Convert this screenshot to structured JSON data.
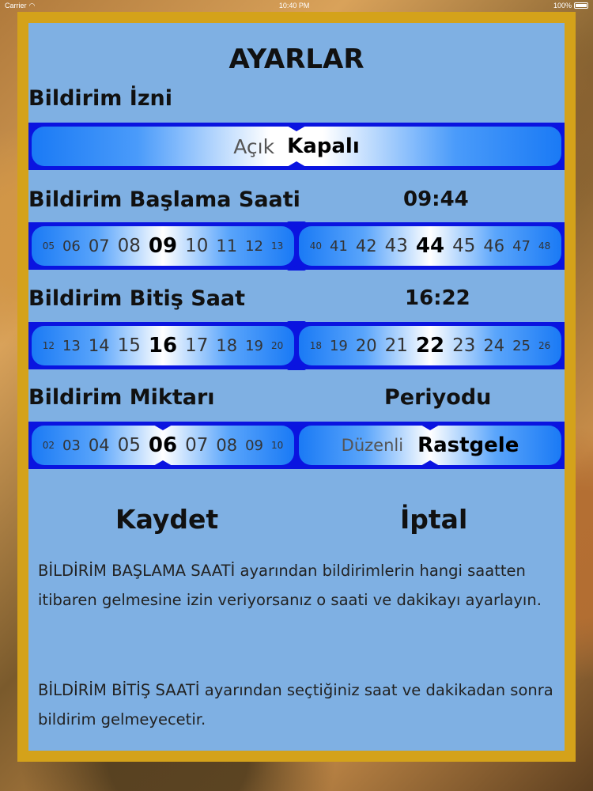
{
  "status_bar": {
    "carrier": "Carrier",
    "time": "10:40 PM",
    "battery": "100%"
  },
  "title": "AYARLAR",
  "permission": {
    "label": "Bildirim İzni",
    "options": [
      "Açık",
      "Kapalı"
    ],
    "selected": "Kapalı"
  },
  "start": {
    "label": "Bildirim Başlama Saati",
    "value": "09:44",
    "hours": [
      "05",
      "06",
      "07",
      "08",
      "09",
      "10",
      "11",
      "12",
      "13"
    ],
    "hour_selected": "09",
    "minutes": [
      "40",
      "41",
      "42",
      "43",
      "44",
      "45",
      "46",
      "47",
      "48"
    ],
    "minute_selected": "44"
  },
  "end": {
    "label": "Bildirim Bitiş Saat",
    "value": "16:22",
    "hours": [
      "12",
      "13",
      "14",
      "15",
      "16",
      "17",
      "18",
      "19",
      "20"
    ],
    "hour_selected": "16",
    "minutes": [
      "18",
      "19",
      "20",
      "21",
      "22",
      "23",
      "24",
      "25",
      "26"
    ],
    "minute_selected": "22"
  },
  "amount": {
    "label": "Bildirim Miktarı",
    "values": [
      "02",
      "03",
      "04",
      "05",
      "06",
      "07",
      "08",
      "09",
      "10"
    ],
    "selected": "06"
  },
  "period": {
    "label": "Periyodu",
    "options": [
      "Düzenli",
      "Rastgele"
    ],
    "selected": "Rastgele"
  },
  "buttons": {
    "save": "Kaydet",
    "cancel": "İptal"
  },
  "help": {
    "p1": "BİLDİRİM BAŞLAMA SAATİ ayarından bildirimlerin hangi saatten itibaren gelmesine izin veriyorsanız o saati ve dakikayı ayarlayın.",
    "p2": "BİLDİRİM BİTİŞ SAATİ ayarından seçtiğiniz saat ve dakikadan sonra bildirim gelmeyecetir."
  }
}
